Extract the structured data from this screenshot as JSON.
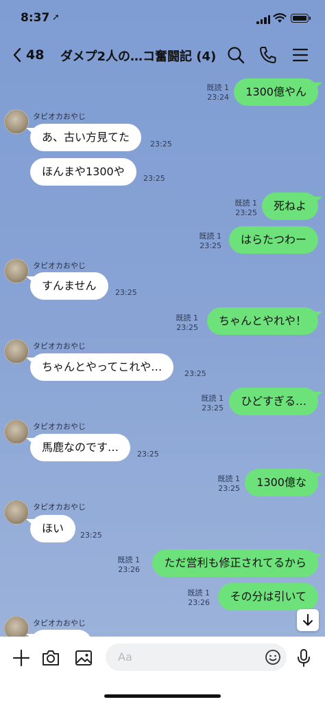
{
  "status": {
    "time": "8:37"
  },
  "header": {
    "back_count": "48",
    "title": "ダメプ2人の…コ奮闘記 (4)"
  },
  "messages": [
    {
      "type": "out",
      "text": "1300億やん",
      "read": "既読 1",
      "time": "23:24"
    },
    {
      "type": "in",
      "sender": "タピオカおやじ",
      "text": "あ、古い方見てた",
      "time": "23:25"
    },
    {
      "type": "in",
      "text": "ほんまや1300や",
      "time": "23:25"
    },
    {
      "type": "out",
      "text": "死ねよ",
      "read": "既読 1",
      "time": "23:25"
    },
    {
      "type": "out",
      "text": "はらたつわー",
      "read": "既読 1",
      "time": "23:25"
    },
    {
      "type": "in",
      "sender": "タピオカおやじ",
      "text": "すんません",
      "time": "23:25"
    },
    {
      "type": "out",
      "text": "ちゃんとやれや！",
      "read": "既読 1",
      "time": "23:25"
    },
    {
      "type": "in",
      "sender": "タピオカおやじ",
      "text": "ちゃんとやってこれや…",
      "time": "23:25"
    },
    {
      "type": "out",
      "text": "ひどすぎる…",
      "read": "既読 1",
      "time": "23:25"
    },
    {
      "type": "in",
      "sender": "タピオカおやじ",
      "text": "馬鹿なのです…",
      "time": "23:25"
    },
    {
      "type": "out",
      "text": "1300億な",
      "read": "既読 1",
      "time": "23:25"
    },
    {
      "type": "in",
      "sender": "タピオカおやじ",
      "text": "ほい",
      "time": "23:25"
    },
    {
      "type": "out",
      "text": "ただ営利も修正されてるから",
      "read": "既読 1",
      "time": "23:26"
    },
    {
      "type": "out",
      "text": "その分は引いて",
      "read": "既読 1",
      "time": "23:26"
    },
    {
      "type": "in",
      "sender": "タピオカおやじ",
      "text": "",
      "time": ""
    }
  ],
  "input": {
    "placeholder": "Aa"
  },
  "icons": {
    "back": "chevron-left-icon",
    "search": "search-icon",
    "call": "phone-icon",
    "menu": "menu-icon",
    "plus": "plus-icon",
    "camera": "camera-icon",
    "image": "image-icon",
    "emoji": "emoji-icon",
    "mic": "mic-icon",
    "scroll": "arrow-down-icon"
  },
  "colors": {
    "outgoing": "#6de27b",
    "incoming": "#ffffff",
    "background": "#88a3d4"
  }
}
